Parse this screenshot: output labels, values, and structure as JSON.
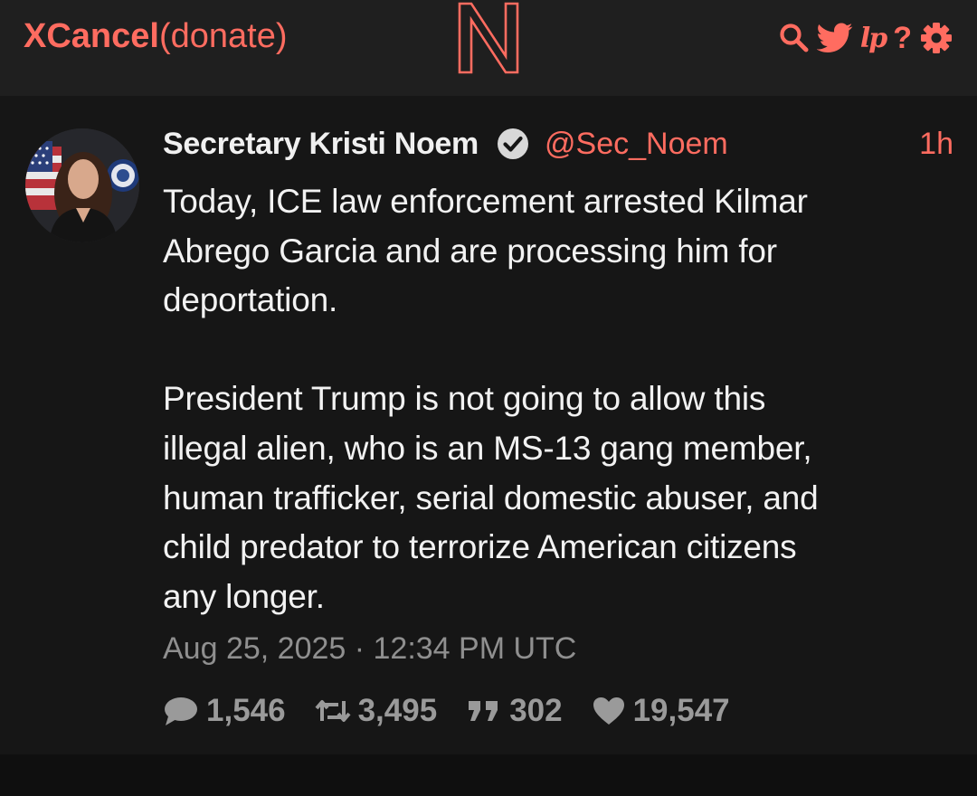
{
  "navbar": {
    "brand_name": "XCancel",
    "brand_donate": "(donate)",
    "logo_letter": "N",
    "icons": [
      "search-icon",
      "twitter-bird-icon",
      "lp-icon",
      "help-icon",
      "gear-icon"
    ],
    "lp_label": "lp",
    "help_label": "?"
  },
  "tweet": {
    "fullname": "Secretary Kristi Noem",
    "username": "@Sec_Noem",
    "time": "1h",
    "verified": true,
    "content": "Today, ICE law enforcement arrested Kilmar\nAbrego Garcia and are processing him for\ndeportation.\n\nPresident Trump is not going to allow this\nillegal alien, who is an MS-13 gang member,\nhuman trafficker, serial domestic abuser, and\nchild predator to terrorize American citizens\nany longer.",
    "date": "Aug 25, 2025 · 12:34 PM UTC",
    "stats": {
      "replies": "1,546",
      "retweets": "3,495",
      "quotes": "302",
      "likes": "19,547"
    }
  },
  "colors": {
    "accent": "#ff6c60",
    "navbar_bg": "#1f1f1f",
    "tweet_bg": "#161616",
    "page_bg": "#0f0f0f",
    "text": "#f2f2f2",
    "muted": "#8f8f8f"
  }
}
